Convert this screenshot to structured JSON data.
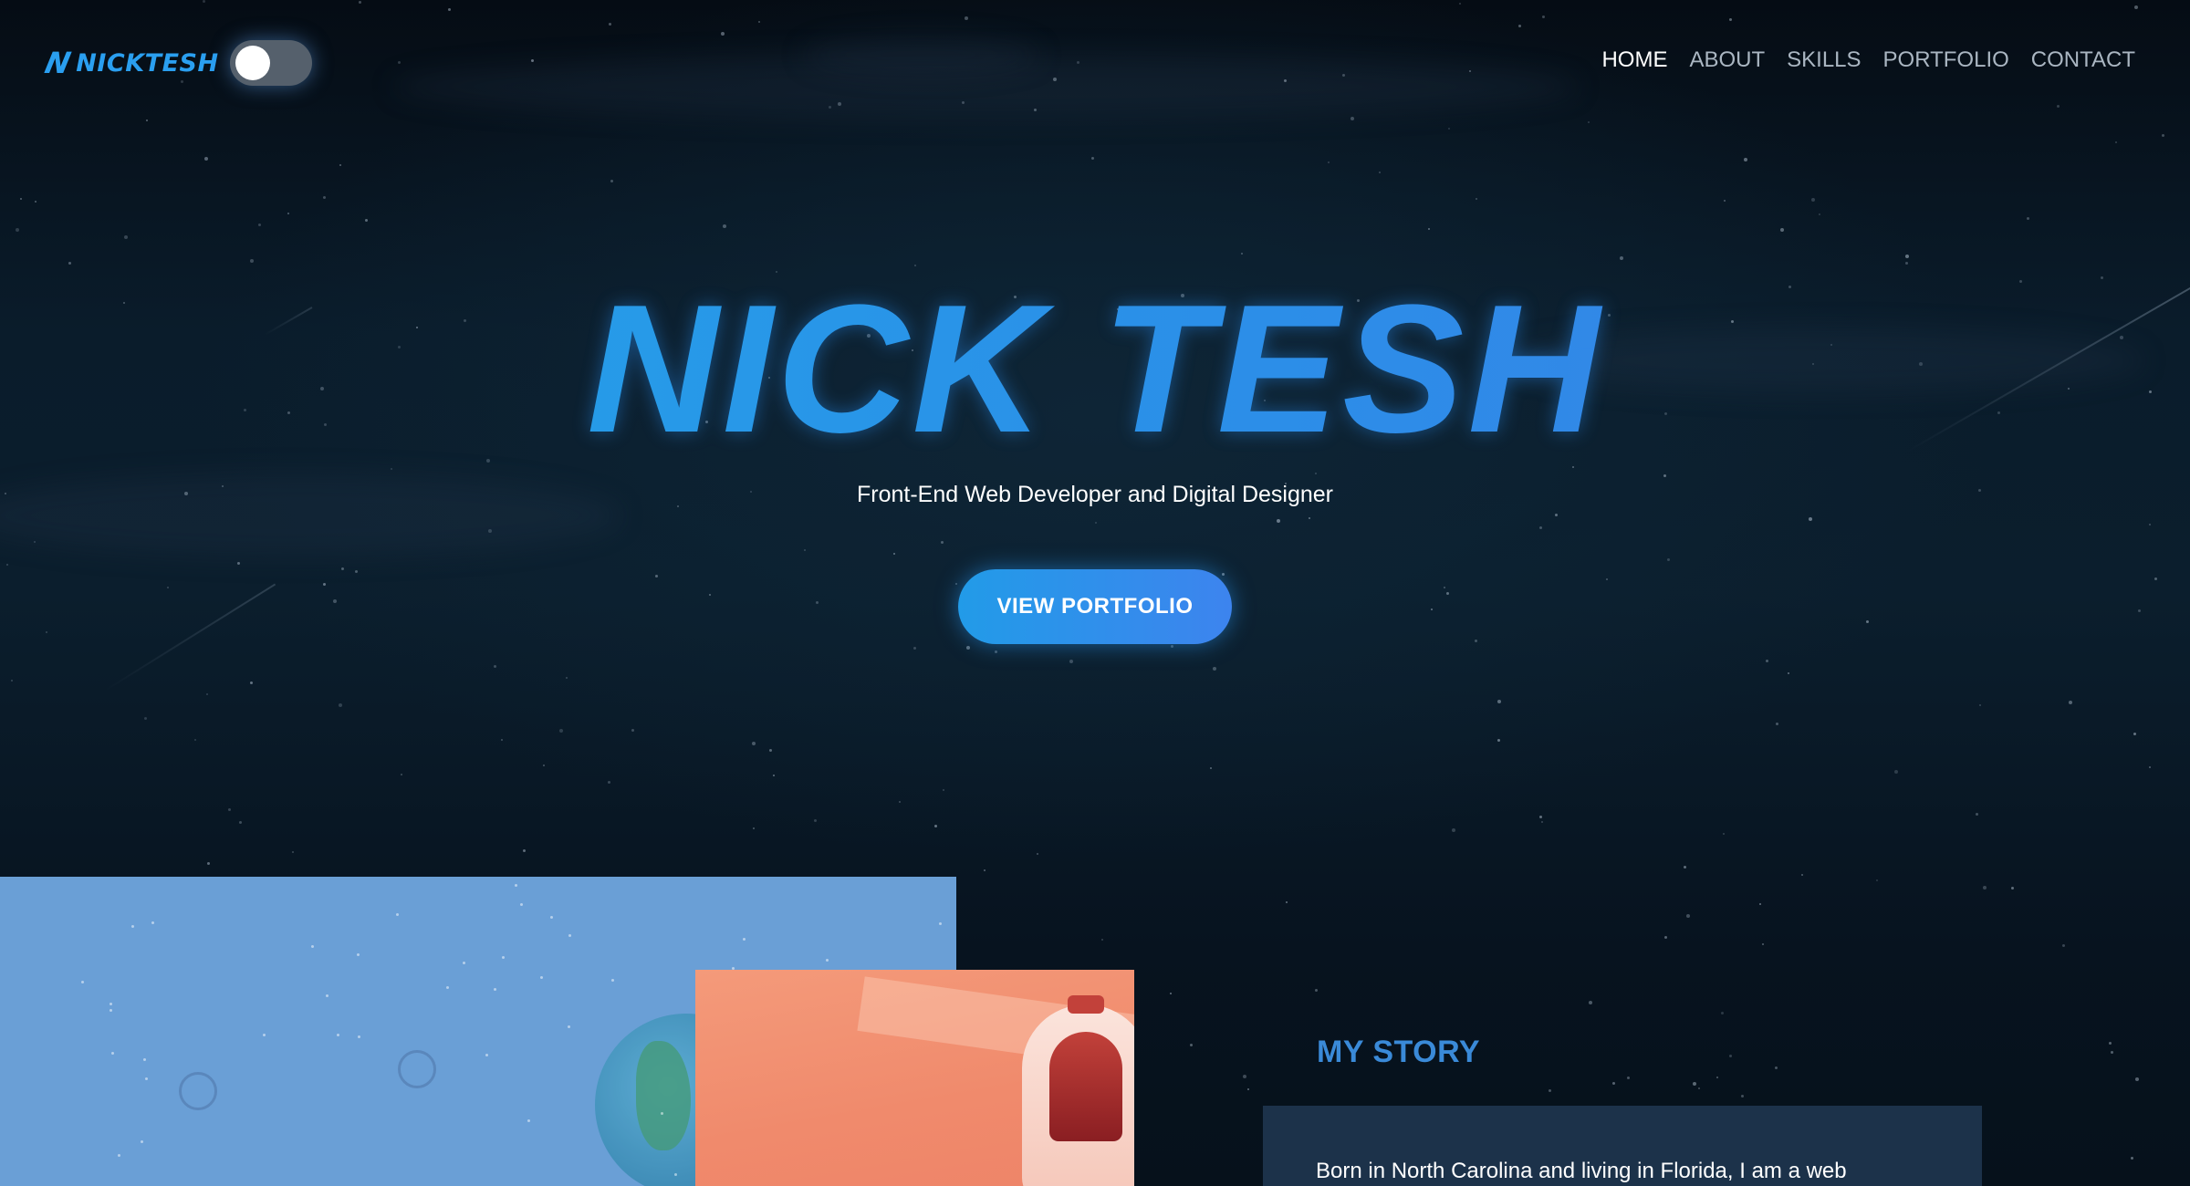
{
  "header": {
    "logo_text": "NICKTESH",
    "logo_mark": "N",
    "theme_toggle": {
      "state": "off"
    }
  },
  "nav": {
    "items": [
      {
        "label": "HOME",
        "active": true
      },
      {
        "label": "ABOUT",
        "active": false
      },
      {
        "label": "SKILLS",
        "active": false
      },
      {
        "label": "PORTFOLIO",
        "active": false
      },
      {
        "label": "CONTACT",
        "active": false
      }
    ]
  },
  "hero": {
    "title": "NICK TESH",
    "subtitle": "Front-End Web Developer and Digital Designer",
    "cta_label": "VIEW PORTFOLIO"
  },
  "about": {
    "heading": "MY STORY",
    "text": "Born in North Carolina and living in Florida, I am a web"
  },
  "colors": {
    "accent": "#2a9ff0",
    "background": "#07131f",
    "panel_blue": "#6a9fd6",
    "card_orange": "#f08a6c",
    "story_card": "#1c324a"
  }
}
